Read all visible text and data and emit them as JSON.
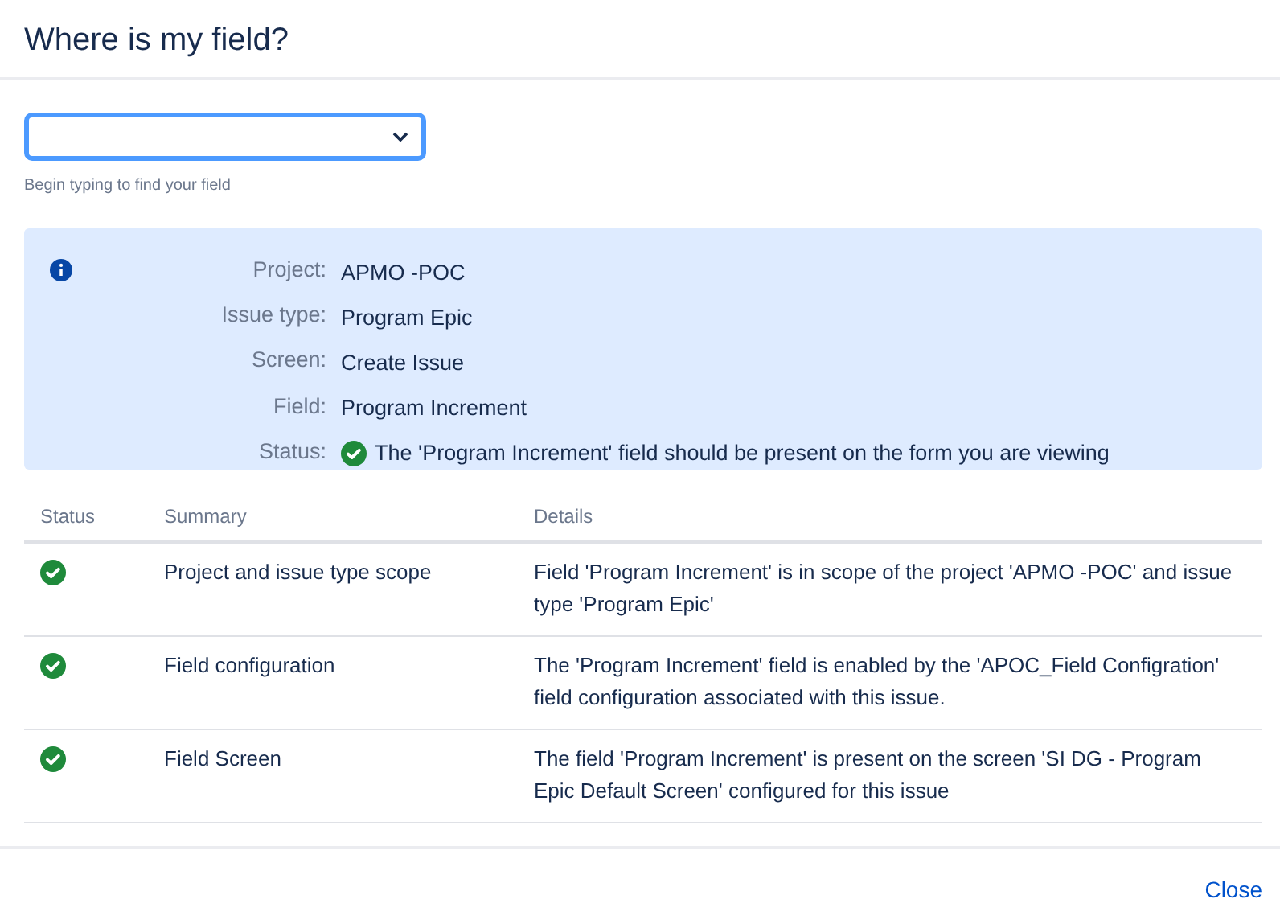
{
  "dialog": {
    "title": "Where is my field?"
  },
  "field_search": {
    "helper": "Begin typing to find your field"
  },
  "info_panel": {
    "rows": [
      {
        "label": "Project:",
        "value": "APMO -POC"
      },
      {
        "label": "Issue type:",
        "value": "Program Epic"
      },
      {
        "label": "Screen:",
        "value": "Create Issue"
      },
      {
        "label": "Field:",
        "value": "Program Increment"
      },
      {
        "label": "Status:",
        "value": "The 'Program Increment' field should be present on the form you are viewing",
        "passed": true
      }
    ]
  },
  "table": {
    "columns": [
      "Status",
      "Summary",
      "Details"
    ],
    "rows": [
      {
        "passed": true,
        "summary": "Project and issue type scope",
        "details": "Field 'Program Increment' is in scope of the project 'APMO -POC' and issue type 'Program Epic'"
      },
      {
        "passed": true,
        "summary": "Field configuration",
        "details": "The 'Program Increment' field is enabled by the 'APOC_Field Configration' field configuration associated with this issue."
      },
      {
        "passed": true,
        "summary": "Field Screen",
        "details": "The field 'Program Increment' is present on the screen 'SI DG - Program Epic Default Screen' configured for this issue"
      }
    ]
  },
  "footer": {
    "close": "Close"
  }
}
